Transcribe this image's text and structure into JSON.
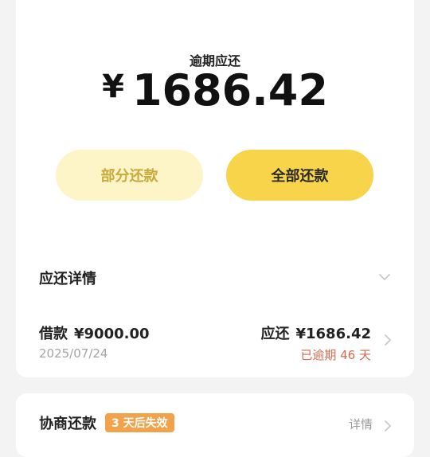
{
  "summary": {
    "due_label": "逾期应还",
    "currency": "¥",
    "amount": "1686.42"
  },
  "actions": {
    "partial_label": "部分还款",
    "full_label": "全部还款"
  },
  "details": {
    "title": "应还详情",
    "loan": {
      "label": "借款",
      "principal": "¥9000.00",
      "date": "2025/07/24",
      "due_label": "应还",
      "due_amount": "¥1686.42",
      "overdue": "已逾期 46 天"
    }
  },
  "negotiate": {
    "title": "协商还款",
    "badge": "3 天后失效",
    "link": "详情"
  },
  "colors": {
    "accent_yellow": "#f8d44a",
    "light_yellow": "#fdf4c8",
    "overdue_red": "#d46a4f",
    "badge_orange": "#f2a24a"
  },
  "icons": {
    "expand": "chevron-down-icon",
    "more": "chevron-right-icon"
  }
}
